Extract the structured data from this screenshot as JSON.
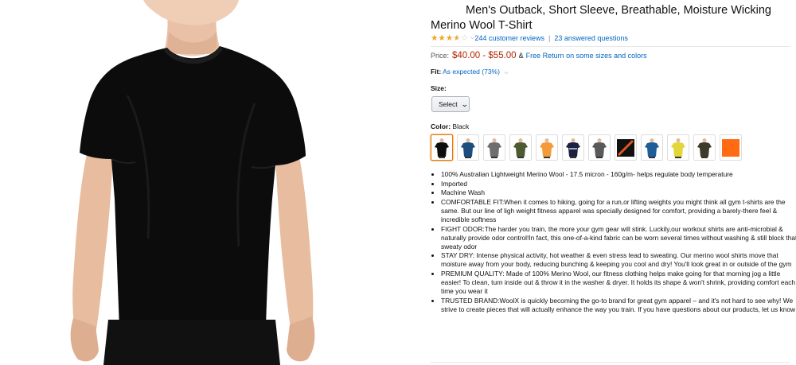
{
  "product": {
    "title": "Men's Outback, Short Sleeve, Breathable, Moisture Wicking Merino Wool T-Shirt",
    "rating_stars": 3.5,
    "reviews_link": "244 customer reviews",
    "questions_link": "23 answered questions",
    "separator": "|"
  },
  "price": {
    "label": "Price:",
    "value": "$40.00 - $55.00",
    "amp": "&",
    "free_return": "Free Return on some sizes and colors"
  },
  "fit": {
    "label": "Fit:",
    "value": "As expected (73%)"
  },
  "size": {
    "label": "Size:",
    "select_value": "Select"
  },
  "color": {
    "label": "Color:",
    "selected": "Black",
    "swatches": [
      {
        "name": "black",
        "hex": "#0d0d0d"
      },
      {
        "name": "navy-blue",
        "hex": "#1d4f7e"
      },
      {
        "name": "gray",
        "hex": "#6e6e6e"
      },
      {
        "name": "olive",
        "hex": "#4e5a32"
      },
      {
        "name": "orange",
        "hex": "#f39b3a"
      },
      {
        "name": "navy-white",
        "hex": "#1b2340"
      },
      {
        "name": "charcoal",
        "hex": "#5a5a5a"
      },
      {
        "name": "orange-black-stripe",
        "hex": "#e4571f"
      },
      {
        "name": "blue",
        "hex": "#1f5e99"
      },
      {
        "name": "yellow",
        "hex": "#e3d63a"
      },
      {
        "name": "dark-olive",
        "hex": "#3e3a2a"
      },
      {
        "name": "bright-orange",
        "hex": "#ff6a13"
      }
    ]
  },
  "bullets": [
    "100% Australian Lightweight Merino Wool - 17.5 micron - 160g/m- helps regulate body temperature",
    "Imported",
    "Machine Wash",
    "COMFORTABLE FIT:When it comes to hiking, going for a run,or lifting weights you might think all gym t-shirts are the same. But our line of ligh weight fitness apparel was specially designed for comfort, providing a barely-there feel & incredible softness",
    "FIGHT ODOR:The harder you train, the more your gym gear will stink. Luckily,our workout shirts are anti-microbial & naturally provide odor control!In fact, this one-of-a-kind fabric can be worn several times without washing & still block that sweaty odor",
    "STAY DRY: Intense physical activity, hot weather & even stress lead to sweating. Our merino wool shirts move that moisture away from your body, reducing bunching & keeping you cool and dry! You'll look great in or outside of the gym",
    "PREMIUM QUALITY: Made of 100% Merino Wool, our fitness clothing helps make going for that morning jog a little easier! To clean, turn inside out & throw it in the washer & dryer. It holds its shape & won't shrink, providing comfort each time you wear it",
    "TRUSTED BRAND:WoolX is quickly becoming the go-to brand for great gym apparel – and it's not hard to see why! We strive to create pieces that will actually enhance the way you train. If you have questions about our products, let us know"
  ],
  "colors": {
    "link": "#0066c0",
    "price": "#b12704",
    "star": "#f0a41c",
    "swatch_selected_border": "#e77600"
  }
}
